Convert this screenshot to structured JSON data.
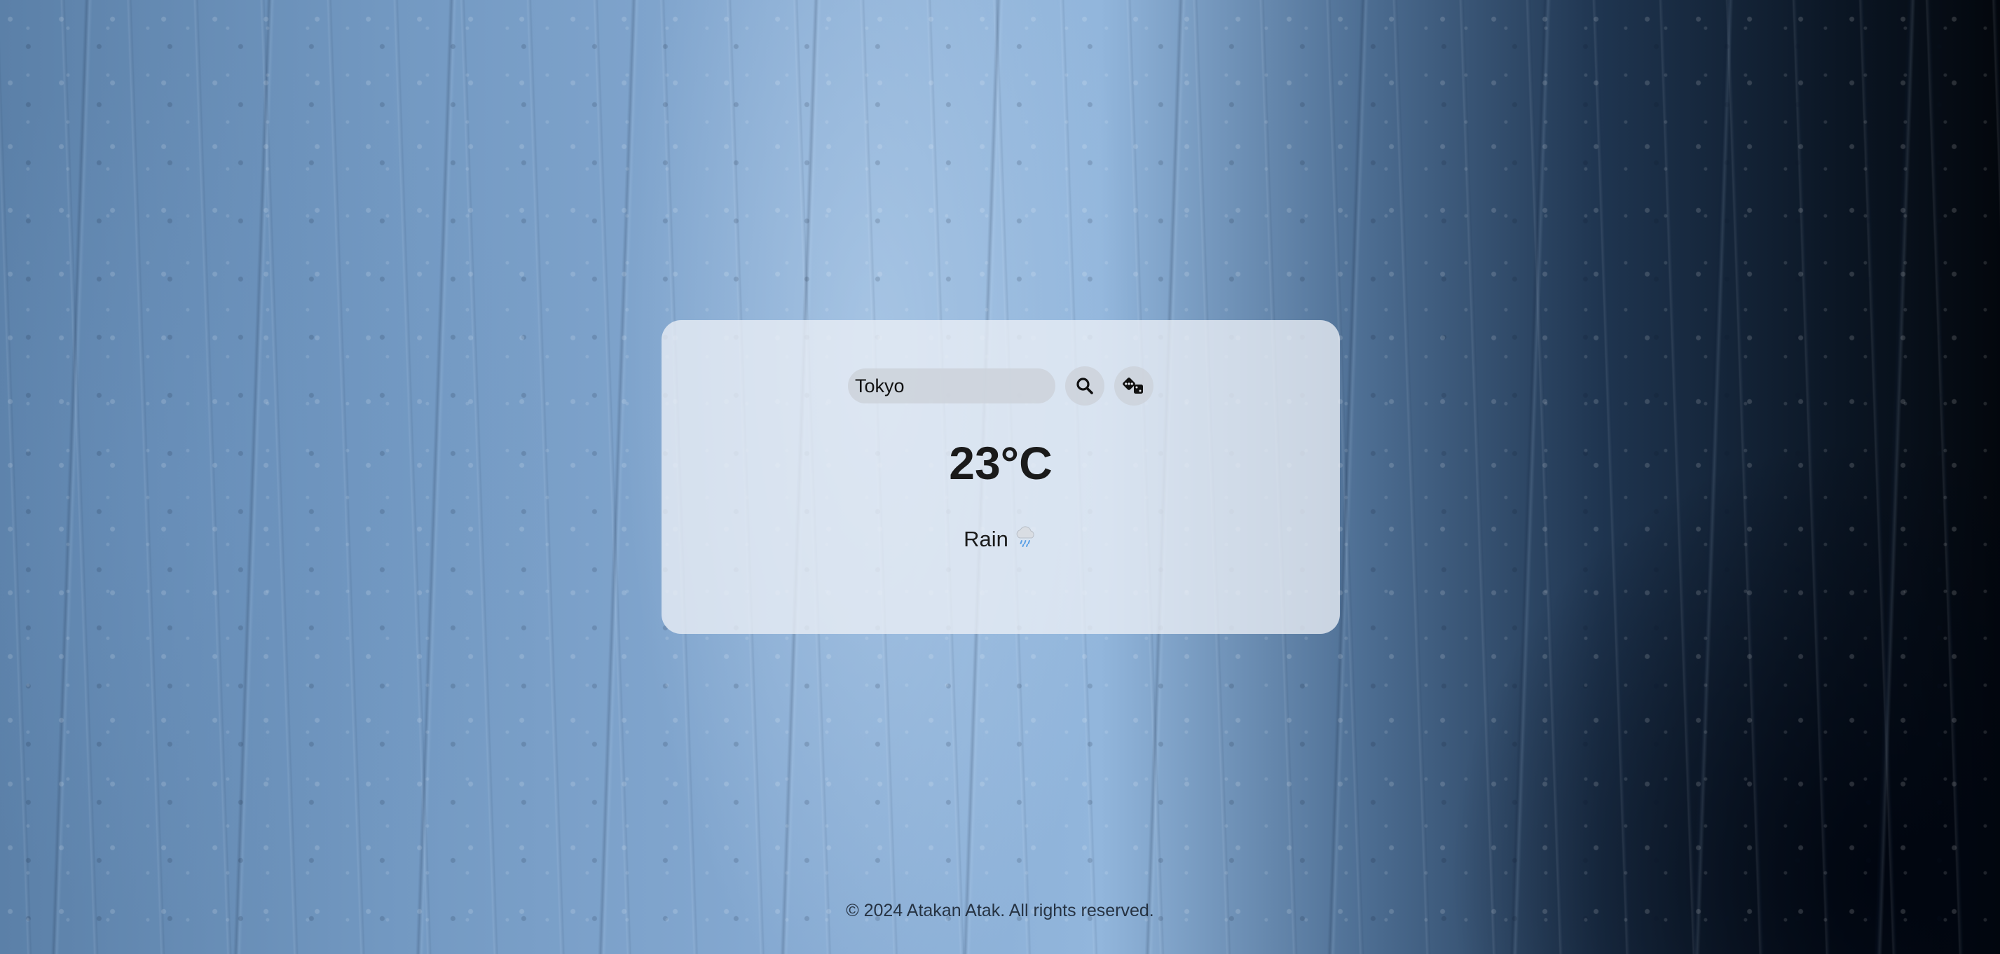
{
  "search": {
    "value": "Tokyo",
    "search_icon": "search-icon",
    "random_icon": "dice-icon"
  },
  "weather": {
    "temperature": "23°C",
    "condition": "Rain",
    "condition_icon": "rain-cloud-icon"
  },
  "footer": {
    "text": "© 2024 Atakan Atak. All rights reserved."
  },
  "colors": {
    "card_bg": "#ecf0f6",
    "text": "#1a1a1a",
    "background_accent": "#86aad2"
  }
}
